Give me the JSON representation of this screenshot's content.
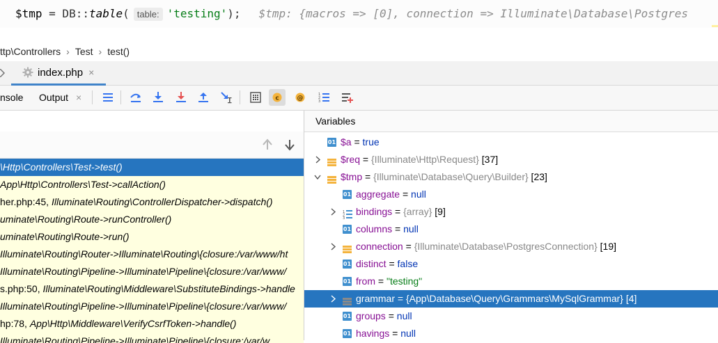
{
  "code": {
    "var": "$tmp",
    "assign": " = DB::",
    "fn": "table",
    "open": "(",
    "hint": "table:",
    "arg": "'testing'",
    "close": ");",
    "inline_value": "$tmp: {macros => [0], connection => Illuminate\\Database\\Postgres"
  },
  "breadcrumb": {
    "items": [
      "ttp\\Controllers",
      "Test",
      "test()"
    ]
  },
  "tabs": [
    {
      "label": "index.php",
      "close": "×"
    }
  ],
  "toolbar": {
    "console_label": "nsole",
    "output_label": "Output",
    "output_close": "×",
    "icons": [
      "menu-icon",
      "step-over-icon",
      "step-into-icon",
      "force-step-into-icon",
      "step-out-icon",
      "run-to-cursor-icon",
      "evaluate-icon",
      "coverage-icon",
      "watch-icon",
      "frames-icon",
      "add-watch-icon"
    ]
  },
  "frames": {
    "items": [
      {
        "prefix": "",
        "italic": "\\Http\\Controllers\\Test->test()",
        "selected": true
      },
      {
        "prefix": " ",
        "italic": "App\\Http\\Controllers\\Test->callAction()",
        "selected": false
      },
      {
        "prefix": "her.php:45, ",
        "italic": "Illuminate\\Routing\\ControllerDispatcher->dispatch()",
        "selected": false
      },
      {
        "prefix": "",
        "italic": "uminate\\Routing\\Route->runController()",
        "selected": false
      },
      {
        "prefix": "",
        "italic": "uminate\\Routing\\Route->run()",
        "selected": false
      },
      {
        "prefix": "",
        "italic": "Illuminate\\Routing\\Router->Illuminate\\Routing\\{closure:/var/www/ht",
        "selected": false
      },
      {
        "prefix": "",
        "italic": "Illuminate\\Routing\\Pipeline->Illuminate\\Pipeline\\{closure:/var/www/",
        "selected": false
      },
      {
        "prefix": "s.php:50, ",
        "italic": "Illuminate\\Routing\\Middleware\\SubstituteBindings->handle",
        "selected": false
      },
      {
        "prefix": "",
        "italic": "Illuminate\\Routing\\Pipeline->Illuminate\\Pipeline\\{closure:/var/www/",
        "selected": false
      },
      {
        "prefix": "hp:78, ",
        "italic": "App\\Http\\Middleware\\VerifyCsrfToken->handle()",
        "selected": false
      },
      {
        "prefix": "",
        "italic": "Illuminate\\Routing\\Pipeline->Illuminate\\Pipeline\\{closure:/var/w",
        "selected": false
      }
    ]
  },
  "variables": {
    "title": "Variables",
    "rows": [
      {
        "depth": 0,
        "expand": "",
        "icon": "badge",
        "name": "$a",
        "eq": " = ",
        "value": "true",
        "vclass": "kw",
        "type": "",
        "count": ""
      },
      {
        "depth": 0,
        "expand": ">",
        "icon": "object",
        "name": "$req",
        "eq": " = ",
        "value": "",
        "vclass": "",
        "type": "{Illuminate\\Http\\Request}",
        "count": " [37]"
      },
      {
        "depth": 0,
        "expand": "v",
        "icon": "object",
        "name": "$tmp",
        "eq": " = ",
        "value": "",
        "vclass": "",
        "type": "{Illuminate\\Database\\Query\\Builder}",
        "count": " [23]"
      },
      {
        "depth": 1,
        "expand": "",
        "icon": "badge",
        "name": "aggregate",
        "eq": " = ",
        "value": "null",
        "vclass": "null",
        "type": "",
        "count": ""
      },
      {
        "depth": 1,
        "expand": ">",
        "icon": "array",
        "name": "bindings",
        "eq": " = ",
        "value": "",
        "vclass": "",
        "type": "{array}",
        "count": " [9]"
      },
      {
        "depth": 1,
        "expand": "",
        "icon": "badge",
        "name": "columns",
        "eq": " = ",
        "value": "null",
        "vclass": "null",
        "type": "",
        "count": ""
      },
      {
        "depth": 1,
        "expand": ">",
        "icon": "object",
        "name": "connection",
        "eq": " = ",
        "value": "",
        "vclass": "",
        "type": "{Illuminate\\Database\\PostgresConnection}",
        "count": " [19]"
      },
      {
        "depth": 1,
        "expand": "",
        "icon": "badge",
        "name": "distinct",
        "eq": " = ",
        "value": "false",
        "vclass": "kw",
        "type": "",
        "count": ""
      },
      {
        "depth": 1,
        "expand": "",
        "icon": "badge",
        "name": "from",
        "eq": " = ",
        "value": "\"testing\"",
        "vclass": "str",
        "type": "",
        "count": ""
      },
      {
        "depth": 1,
        "expand": ">",
        "icon": "object",
        "name": "grammar",
        "eq": " = ",
        "value": "",
        "vclass": "",
        "type": "{App\\Database\\Query\\Grammars\\MySqlGrammar}",
        "count": " [4]",
        "selected": true
      },
      {
        "depth": 1,
        "expand": "",
        "icon": "badge",
        "name": "groups",
        "eq": " = ",
        "value": "null",
        "vclass": "null",
        "type": "",
        "count": ""
      },
      {
        "depth": 1,
        "expand": "",
        "icon": "badge",
        "name": "havings",
        "eq": " = ",
        "value": "null",
        "vclass": "null",
        "type": "",
        "count": ""
      }
    ]
  },
  "badge_text": "01",
  "colors": {
    "accent": "#2675bf",
    "frame_bg": "#ffffe0",
    "var_name": "#871094",
    "keyword": "#0033b3",
    "string": "#067d17"
  }
}
